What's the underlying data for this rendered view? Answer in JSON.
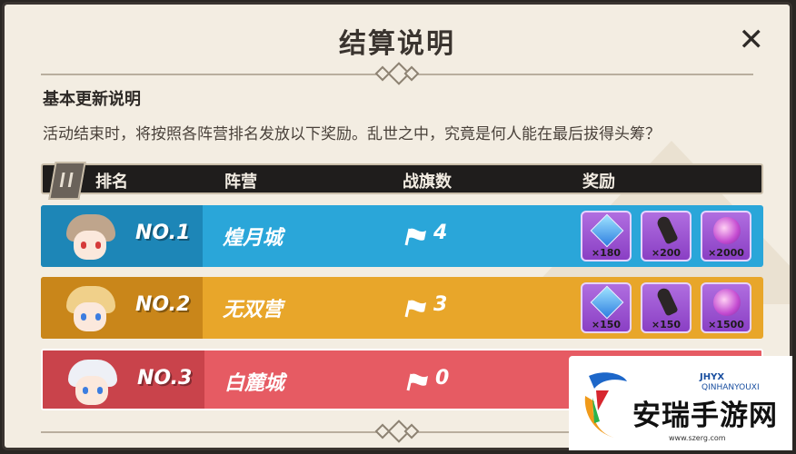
{
  "dialog": {
    "title": "结算说明",
    "close_icon": "close-icon",
    "section_title": "基本更新说明",
    "description": "活动结束时，将按照各阵营排名发放以下奖励。乱世之中，究竟是何人能在最后拔得头筹？"
  },
  "table": {
    "headers": [
      "排名",
      "阵营",
      "战旗数",
      "奖励"
    ],
    "rows": [
      {
        "rank": "NO.1",
        "camp": "煌月城",
        "flags": "4",
        "color": "#2aa6d9",
        "left_color": "#1d86b7",
        "hair": "#bfa58c",
        "eye": "#d53b3b",
        "rewards": [
          {
            "icon": "blue-crystal-icon",
            "count": "×180"
          },
          {
            "icon": "brush-icon",
            "count": "×200"
          },
          {
            "icon": "purple-orb-icon",
            "count": "×2000"
          }
        ]
      },
      {
        "rank": "NO.2",
        "camp": "无双营",
        "flags": "3",
        "color": "#e8a62a",
        "left_color": "#c9861a",
        "hair": "#f0d08a",
        "eye": "#3c7de0",
        "rewards": [
          {
            "icon": "blue-crystal-icon",
            "count": "×150"
          },
          {
            "icon": "brush-icon",
            "count": "×150"
          },
          {
            "icon": "purple-orb-icon",
            "count": "×1500"
          }
        ]
      },
      {
        "rank": "NO.3",
        "camp": "白麓城",
        "flags": "0",
        "color": "#e65b63",
        "left_color": "#c9434b",
        "hair": "#eef0f6",
        "eye": "#3c7de0",
        "rewards": [
          {
            "icon": "blue-crystal-icon",
            "count": ""
          },
          {
            "icon": "brush-icon",
            "count": ""
          },
          {
            "icon": "purple-orb-icon",
            "count": ""
          }
        ]
      }
    ]
  },
  "watermark": {
    "brand_small": "JHYX",
    "brand_pinyin": "QINHANYOUXI",
    "brand_big": "安瑞手游网",
    "url": "www.szerg.com"
  }
}
